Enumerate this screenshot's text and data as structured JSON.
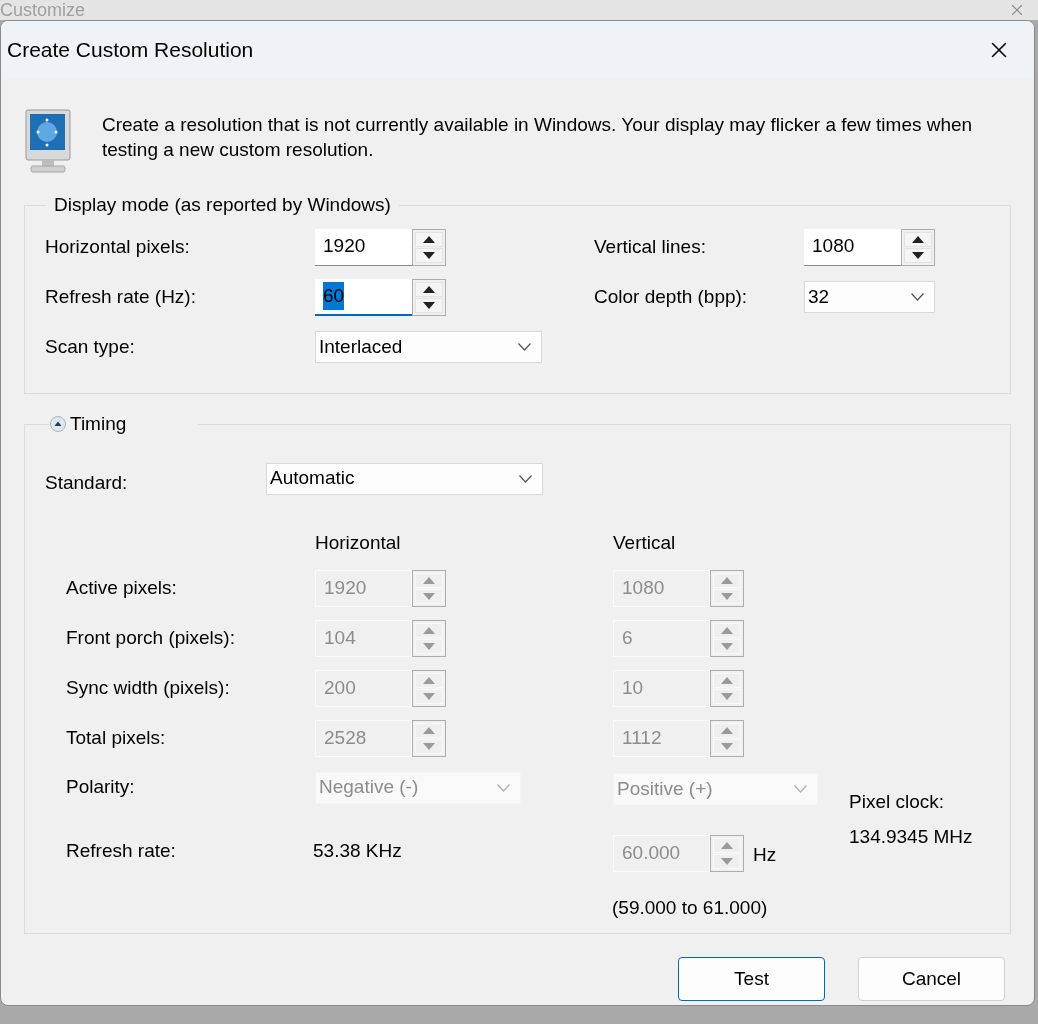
{
  "background_window": {
    "title": "Customize"
  },
  "dialog": {
    "title": "Create Custom Resolution"
  },
  "intro": "Create a resolution that is not currently available in Windows. Your display may flicker a few times when testing a new custom resolution.",
  "display_mode": {
    "legend": "Display mode (as reported by Windows)",
    "left_fields": [
      {
        "kind": "spin",
        "label": "Horizontal pixels:",
        "value": "1920",
        "focused": false
      },
      {
        "kind": "spin",
        "label": "Refresh rate (Hz):",
        "value": "60",
        "focused": true
      },
      {
        "kind": "dropdown",
        "label": "Scan type:",
        "value": "Interlaced"
      }
    ],
    "right_fields": [
      {
        "kind": "spin",
        "label": "Vertical lines:",
        "value": "1080",
        "focused": false
      },
      {
        "kind": "dropdown",
        "label": "Color depth (bpp):",
        "value": "32"
      }
    ]
  },
  "timing": {
    "legend": "Timing",
    "expanded": true,
    "disabled": true,
    "standard": {
      "label": "Standard:",
      "value": "Automatic"
    },
    "column_headers": [
      "Horizontal",
      "Vertical"
    ],
    "rows": [
      {
        "label": "Active pixels:",
        "horizontal": "1920",
        "vertical": "1080"
      },
      {
        "label": "Front porch (pixels):",
        "horizontal": "104",
        "vertical": "6"
      },
      {
        "label": "Sync width (pixels):",
        "horizontal": "200",
        "vertical": "10"
      },
      {
        "label": "Total pixels:",
        "horizontal": "2528",
        "vertical": "1112"
      }
    ],
    "polarity": {
      "label": "Polarity:",
      "horizontal": "Negative (-)",
      "vertical": "Positive (+)"
    },
    "refresh": {
      "label": "Refresh rate:",
      "horizontal": "53.38 KHz",
      "vertical": "60.000",
      "unit": "Hz",
      "range": "(59.000 to 61.000)"
    },
    "pixel_clock": {
      "label": "Pixel clock:",
      "value": "134.9345 MHz"
    }
  },
  "buttons": [
    {
      "label": "Test",
      "default": true
    },
    {
      "label": "Cancel",
      "default": false
    }
  ]
}
